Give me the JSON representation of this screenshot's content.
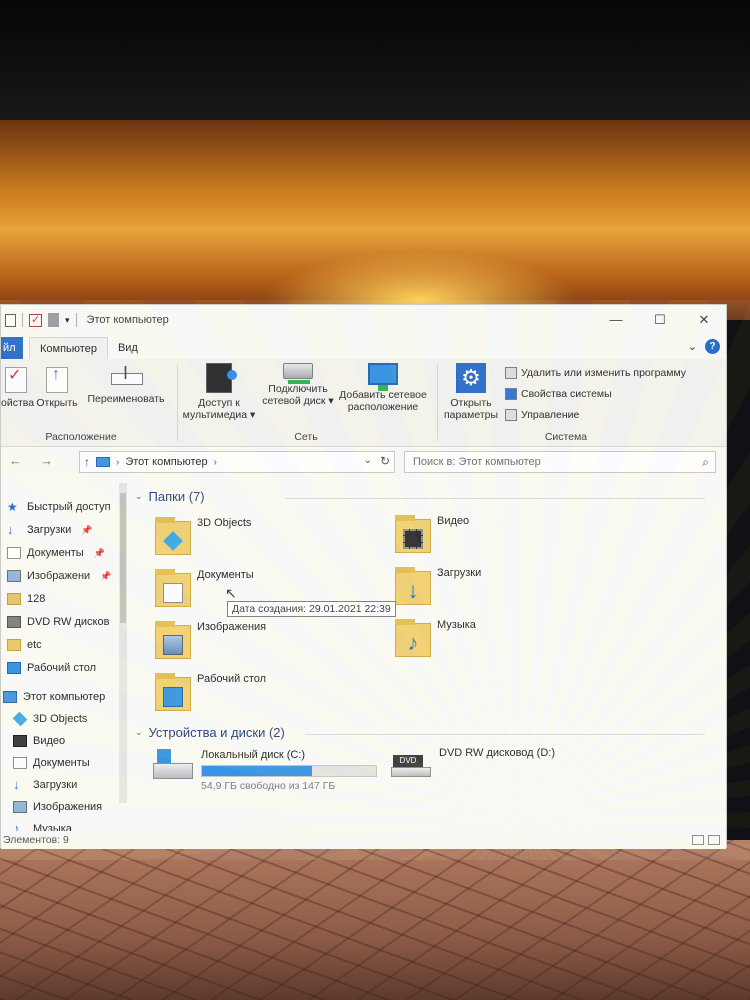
{
  "window": {
    "title": "Этот компьютер",
    "controls": {
      "minimize": "—",
      "maximize": "☐",
      "close": "✕"
    }
  },
  "tabs": {
    "file": "йл",
    "computer": "Компьютер",
    "view": "Вид"
  },
  "ribbon": {
    "properties_label": "ойства",
    "open_label": "Открыть",
    "rename_label": "Переименовать",
    "location_group": "Расположение",
    "media_label_1": "Доступ к",
    "media_label_2": "мультимедиа ▾",
    "map_drive_label_1": "Подключить",
    "map_drive_label_2": "сетевой диск ▾",
    "add_location_label_1": "Добавить сетевое",
    "add_location_label_2": "расположение",
    "network_group": "Сеть",
    "settings_label_1": "Открыть",
    "settings_label_2": "параметры",
    "uninstall_label": "Удалить или изменить программу",
    "system_props_label": "Свойства системы",
    "manage_label": "Управление",
    "system_group": "Система"
  },
  "address": {
    "path": "Этот компьютер",
    "search_placeholder": "Поиск в: Этот компьютер"
  },
  "nav": {
    "quick_access": "Быстрый доступ",
    "items": [
      "Загрузки",
      "Документы",
      "Изображени",
      "128",
      "DVD RW дисков",
      "etc",
      "Рабочий стол"
    ],
    "this_pc": "Этот компьютер",
    "pc_items": [
      "3D Objects",
      "Видео",
      "Документы",
      "Загрузки",
      "Изображения",
      "Музыка"
    ]
  },
  "content": {
    "folders_header": "Папки (7)",
    "folders": [
      "3D Objects",
      "Видео",
      "Документы",
      "Загрузки",
      "Изображения",
      "Музыка",
      "Рабочий стол"
    ],
    "tooltip": "Дата создания: 29.01.2021 22:39",
    "devices_header": "Устройства и диски (2)",
    "local_disk": {
      "name": "Локальный диск (C:)",
      "free": "54,9 ГБ свободно из 147 ГБ",
      "used_fraction": 0.63
    },
    "dvd_drive": {
      "name": "DVD RW дисковод (D:)",
      "badge": "DVD"
    }
  },
  "status": {
    "count": "Элементов: 9"
  }
}
